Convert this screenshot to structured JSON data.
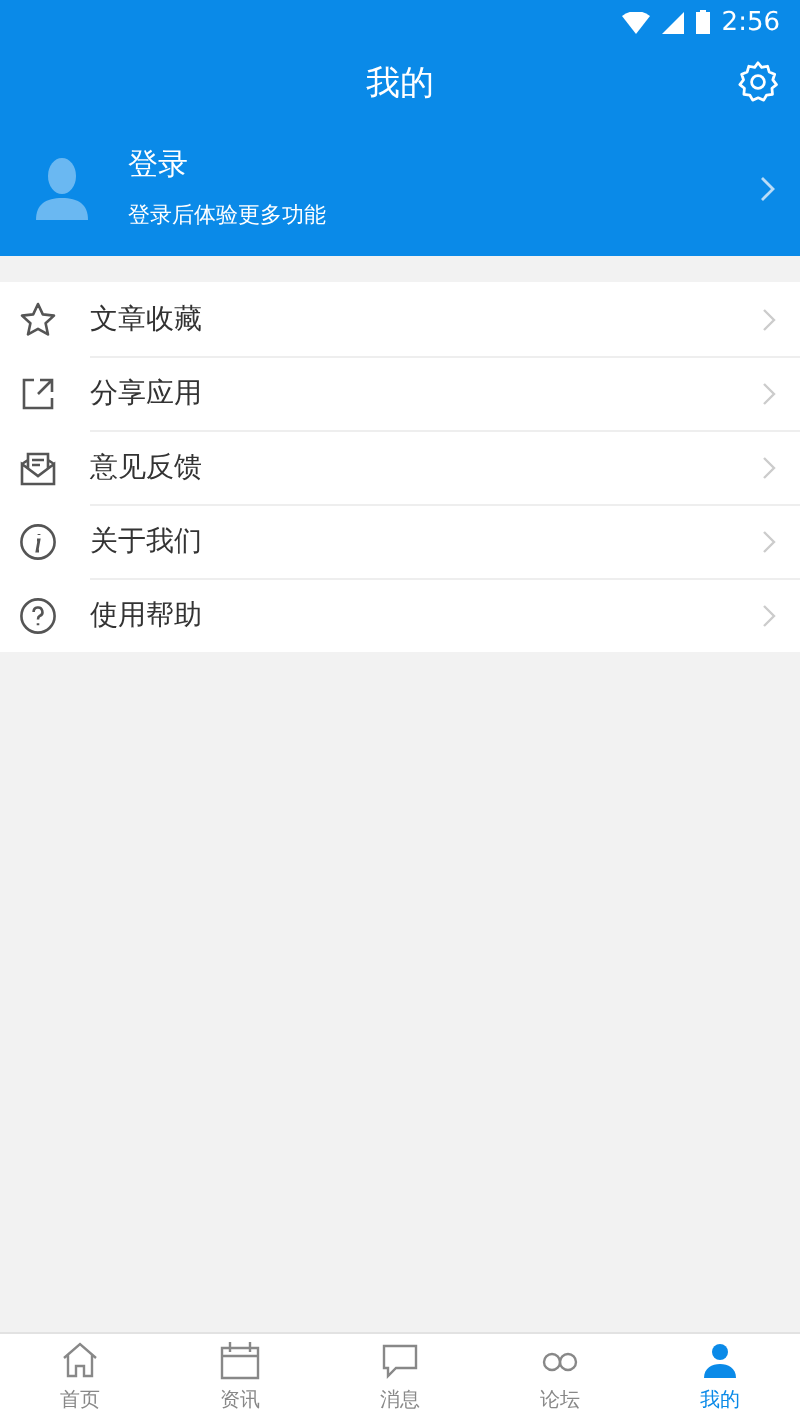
{
  "status_bar": {
    "time": "2:56"
  },
  "header": {
    "title": "我的"
  },
  "login": {
    "title": "登录",
    "subtitle": "登录后体验更多功能"
  },
  "menu": [
    {
      "kind": "star",
      "label": "文章收藏"
    },
    {
      "kind": "share",
      "label": "分享应用"
    },
    {
      "kind": "mail",
      "label": "意见反馈"
    },
    {
      "kind": "info",
      "label": "关于我们"
    },
    {
      "kind": "help",
      "label": "使用帮助"
    }
  ],
  "nav": [
    {
      "kind": "home",
      "label": "首页",
      "selected": false
    },
    {
      "kind": "calendar",
      "label": "资讯",
      "selected": false
    },
    {
      "kind": "message",
      "label": "消息",
      "selected": false
    },
    {
      "kind": "forum",
      "label": "论坛",
      "selected": false
    },
    {
      "kind": "user",
      "label": "我的",
      "selected": true
    }
  ]
}
